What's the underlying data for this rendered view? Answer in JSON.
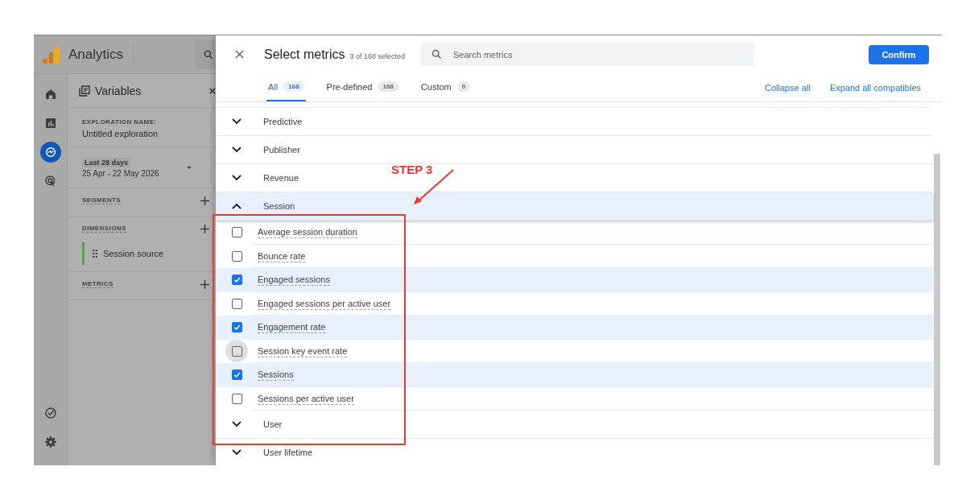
{
  "app": {
    "name": "Analytics"
  },
  "rail": [
    {
      "kind": "home",
      "selected": false
    },
    {
      "kind": "reports",
      "selected": false
    },
    {
      "kind": "explore",
      "selected": true
    },
    {
      "kind": "advertising",
      "selected": false
    }
  ],
  "rail_bottom": [
    {
      "kind": "check",
      "selected": false
    },
    {
      "kind": "settings",
      "selected": false
    }
  ],
  "variables": {
    "title": "Variables",
    "exploration_label": "EXPLORATION NAME:",
    "exploration_name": "Untitled exploration",
    "date_badge": "Last 28 days",
    "date_range": "25 Apr - 22 May 2026",
    "sections": [
      {
        "title": "SEGMENTS"
      },
      {
        "title": "DIMENSIONS",
        "items": [
          "Session source"
        ]
      },
      {
        "title": "METRICS"
      }
    ]
  },
  "dialog": {
    "title": "Select metrics",
    "count": "3 of 168 selected",
    "search": {
      "placeholder": "Search metrics"
    },
    "confirm": "Confirm",
    "tabs": [
      {
        "label": "All",
        "count": "168",
        "selected": true
      },
      {
        "label": "Pre-defined",
        "count": "168",
        "selected": false
      },
      {
        "label": "Custom",
        "count": "0",
        "selected": false
      }
    ],
    "links": [
      "Collapse all",
      "Expand all compatibles"
    ],
    "groups": [
      {
        "name": "Predictive",
        "expanded": false
      },
      {
        "name": "Publisher",
        "expanded": false
      },
      {
        "name": "Revenue",
        "expanded": false
      },
      {
        "name": "Session",
        "expanded": true,
        "metrics": [
          {
            "name": "Average session duration",
            "checked": false,
            "hovered": false
          },
          {
            "name": "Bounce rate",
            "checked": false,
            "hovered": false
          },
          {
            "name": "Engaged sessions",
            "checked": true,
            "hovered": false
          },
          {
            "name": "Engaged sessions per active user",
            "checked": false,
            "hovered": false
          },
          {
            "name": "Engagement rate",
            "checked": true,
            "hovered": false
          },
          {
            "name": "Session key event rate",
            "checked": false,
            "hovered": true
          },
          {
            "name": "Sessions",
            "checked": true,
            "hovered": false
          },
          {
            "name": "Sessions per active user",
            "checked": false,
            "hovered": false
          }
        ]
      },
      {
        "name": "User",
        "expanded": false
      },
      {
        "name": "User lifetime",
        "expanded": false
      }
    ]
  },
  "annotation": {
    "label": "STEP 3"
  }
}
